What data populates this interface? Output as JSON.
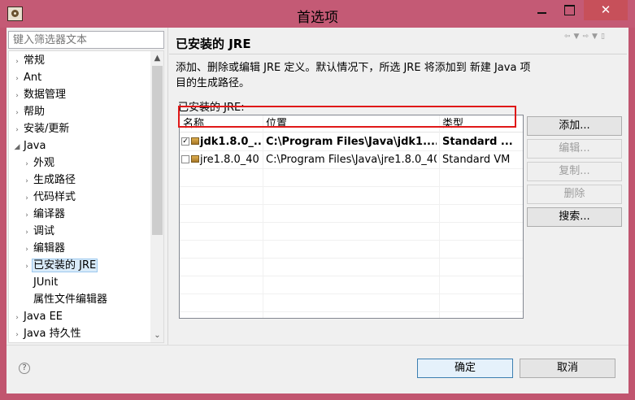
{
  "window": {
    "title": "首选项",
    "close_symbol": "✕"
  },
  "filter": {
    "placeholder": "键入筛选器文本"
  },
  "tree": {
    "items": [
      {
        "label": "常规",
        "arrow": "›"
      },
      {
        "label": "Ant",
        "arrow": "›"
      },
      {
        "label": "数据管理",
        "arrow": "›"
      },
      {
        "label": "帮助",
        "arrow": "›"
      },
      {
        "label": "安装/更新",
        "arrow": "›"
      },
      {
        "label": "Java",
        "arrow": "◢"
      },
      {
        "label": "外观",
        "arrow": "›"
      },
      {
        "label": "生成路径",
        "arrow": "›"
      },
      {
        "label": "代码样式",
        "arrow": "›"
      },
      {
        "label": "编译器",
        "arrow": "›"
      },
      {
        "label": "调试",
        "arrow": "›"
      },
      {
        "label": "编辑器",
        "arrow": "›"
      },
      {
        "label": "已安装的 JRE",
        "arrow": "›"
      },
      {
        "label": "JUnit",
        "arrow": ""
      },
      {
        "label": "属性文件编辑器",
        "arrow": ""
      },
      {
        "label": "Java EE",
        "arrow": "›"
      },
      {
        "label": "Java 持久性",
        "arrow": "›"
      }
    ]
  },
  "page": {
    "title": "已安装的 JRE",
    "description": "添加、删除或编辑 JRE 定义。默认情况下，所选 JRE 将添加到 新建 Java 项目的生成路径。",
    "installed_label": "已安装的 JRE:"
  },
  "table": {
    "columns": [
      "名称",
      "位置",
      "类型"
    ],
    "rows": [
      {
        "name": "jdk1.8.0_...",
        "location": "C:\\Program Files\\Java\\jdk1....",
        "type": "Standard ...",
        "checked": true
      },
      {
        "name": "jre1.8.0_40",
        "location": "C:\\Program Files\\Java\\jre1.8.0_40",
        "type": "Standard VM",
        "checked": false
      }
    ]
  },
  "buttons": {
    "add": "添加...",
    "edit": "编辑...",
    "copy": "复制...",
    "remove": "删除",
    "search": "搜索...",
    "ok": "确定",
    "cancel": "取消"
  },
  "icons": {
    "help": "question-icon",
    "checkmark": "✓"
  }
}
